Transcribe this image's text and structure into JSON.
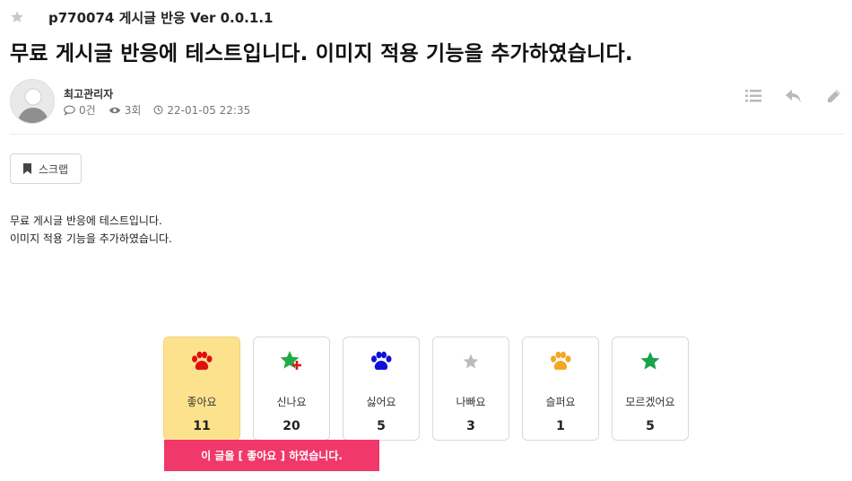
{
  "board": {
    "name": "p770074 게시글 반응 Ver 0.0.1.1",
    "icon": "star-icon"
  },
  "post": {
    "title": "무료 게시글 반응에 테스트입니다. 이미지 적용 기능을 추가하였습니다.",
    "body_lines": [
      "무료 게시글 반응에 테스트입니다.",
      "이미지 적용 기능을 추가하였습니다."
    ]
  },
  "author": {
    "name": "최고관리자",
    "comments": "0건",
    "views": "3회",
    "datetime": "22-01-05 22:35"
  },
  "tools": [
    "list-icon",
    "reply-icon",
    "edit-icon"
  ],
  "scrap": {
    "label": "스크랩"
  },
  "reactions": [
    {
      "label": "좋아요",
      "count": "11",
      "icon": "paw-icon",
      "color": "#e01010",
      "active": true
    },
    {
      "label": "신나요",
      "count": "20",
      "icon": "star-plus-icon",
      "color": "#22aa44",
      "active": false
    },
    {
      "label": "싫어요",
      "count": "5",
      "icon": "paw-icon",
      "color": "#1010d8",
      "active": false
    },
    {
      "label": "나빠요",
      "count": "3",
      "icon": "star-icon",
      "color": "#bbbbbb",
      "active": false
    },
    {
      "label": "슬퍼요",
      "count": "1",
      "icon": "paw-icon",
      "color": "#f5a623",
      "active": false
    },
    {
      "label": "모르겠어요",
      "count": "5",
      "icon": "star-icon",
      "color": "#16a34a",
      "active": false
    }
  ],
  "notice": {
    "text": "이 글을 [ 좋아요 ] 하였습니다."
  },
  "colors": {
    "active_bg": "#fde28e",
    "notice_bg": "#f0386b"
  }
}
